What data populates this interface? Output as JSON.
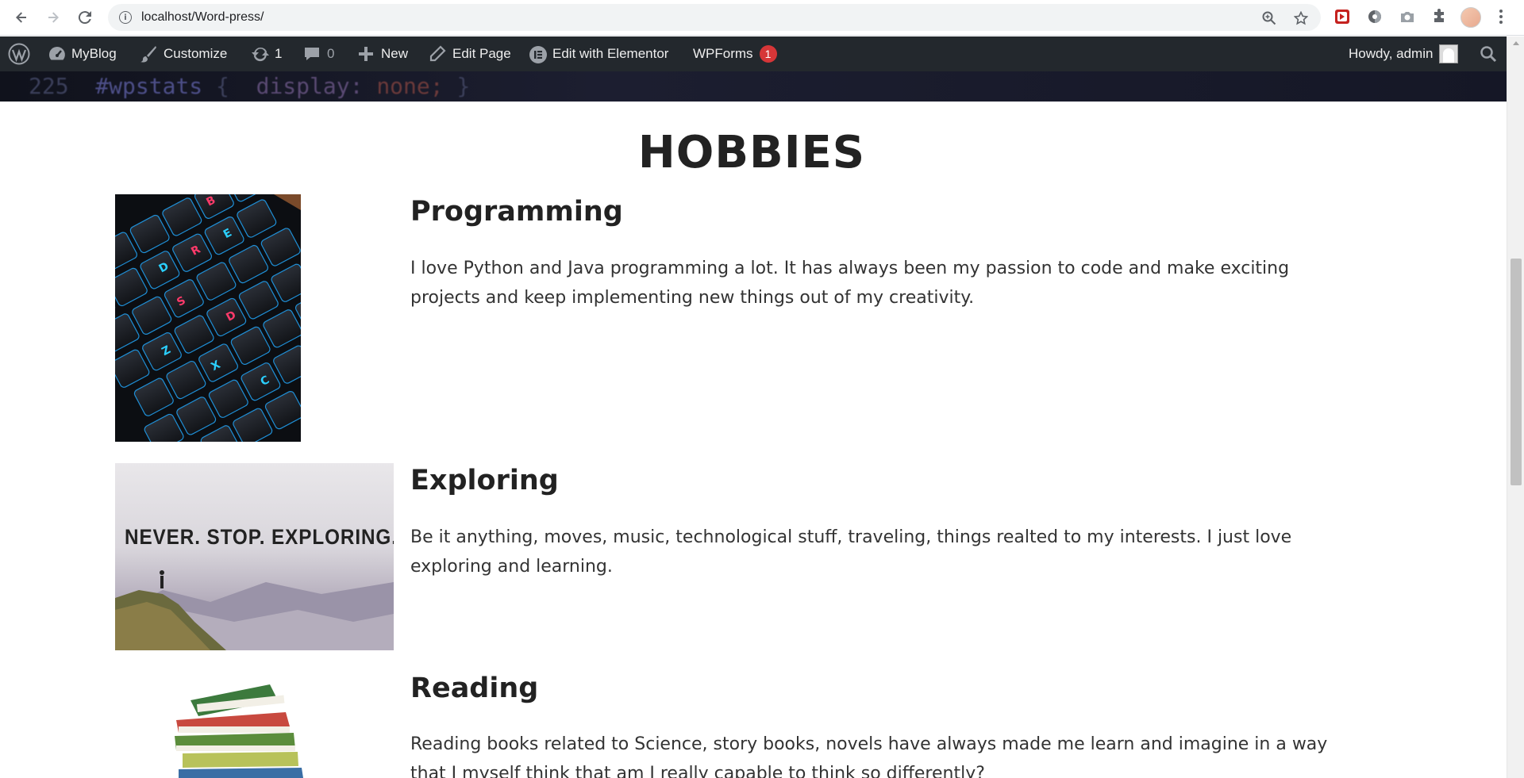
{
  "browser": {
    "url": "localhost/Word-press/",
    "info_icon_glyph": "i"
  },
  "adminbar": {
    "site_name": "MyBlog",
    "customize": "Customize",
    "updates_count": "1",
    "comments_count": "0",
    "new_label": "New",
    "edit_page": "Edit Page",
    "elementor": "Edit with Elementor",
    "wpforms": "WPForms",
    "wpforms_badge": "1",
    "howdy": "Howdy, admin",
    "bg_color": "#23282d",
    "badge_color": "#d63638"
  },
  "banner": {
    "line_number": "225",
    "selector": "#wpstats",
    "open": "{",
    "property": "display:",
    "value": "none;",
    "close": "}"
  },
  "page": {
    "heading": "HOBBIES",
    "hobbies": [
      {
        "title": "Programming",
        "text": "I love Python and Java programming a lot. It has always been my passion to code and make exciting projects and keep implementing new things out of my creativity."
      },
      {
        "title": "Exploring",
        "text": "Be it anything, moves, music, technological stuff, traveling, things realted to my interests. I just love exploring and learning.",
        "image_text": "NEVER. STOP. EXPLORING."
      },
      {
        "title": "Reading",
        "text": "Reading books related to Science, story books, novels have always made me learn and imagine in a way that I myself think that am I really capable to think so differently?"
      }
    ]
  }
}
